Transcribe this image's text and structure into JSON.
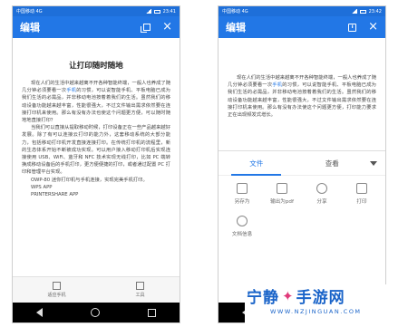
{
  "left_phone": {
    "status": {
      "carrier": "中国移动 4G",
      "time": "23:41"
    },
    "appbar": {
      "title": "编辑"
    },
    "doc": {
      "title": "让打印随时随地",
      "paragraphs": [
        {
          "before": "现在人们的生活中越来越离不开各种智能终端，一般人也养成了随几分钟必须要看一次",
          "highlight": "手机",
          "after": "的习惯，可以说智能手机、平板电脑已成为我们生活的必需品，并非移动电池按着着我们的生活。虽然我们的移动设备功能越来越丰富，性能很强大，不过文件输出需求依然要在连接打印机来使用。那么有没有办法也使这个问题更方便，可以随时随地地直接打印？"
        },
        {
          "before": "当我们可以直接从提取移动时候，打印设备正在一些产品越来越好发展。除了有可以连接云打印的能力外，这套移动系统的大部分能力，包括移动打印机开发直接连接打印。在传统打印机的流程里，新的生态体系开始不断被成功实现。可以用户接入移动打印机后实现连接使用 USB、WiFi、蓝牙和 NFC 技术实现无线打印，比如 PC 端转换成移动设备后的手机打印，更方便便捷的打印，或者通过配置 PC 打印和管理平台实现。",
          "highlight": "",
          "after": ""
        }
      ],
      "lines": [
        "OWP-80 迷你打印机与手机连接，实现完美手机打印。",
        "WPS APP",
        "PRINTERSHARE APP"
      ]
    },
    "bottom_bar": [
      {
        "label": "适应手机",
        "icon": "fit-screen-icon"
      },
      {
        "label": "工具",
        "icon": "toolbox-icon"
      }
    ]
  },
  "right_phone": {
    "status": {
      "carrier": "中国移动 4G",
      "time": "23:42"
    },
    "appbar": {
      "title": "编辑"
    },
    "doc": {
      "paragraphs": [
        {
          "before": "现在人们的生活中越来越离不开各种智能终端，一般人也养成了随几分钟必须要看一次",
          "highlight": "手机",
          "after": "的习惯，可以说智能手机、平板电脑已成为我们生活的必需品，并非移动电池按着着我们的生活。虽然我们的移动设备功能越来越丰富，性能很强大，不过文件输出需求依然要在连接打印机来使用。那么有没有办法使这个问题更方便，打印能力要求正在出现频发式增长。"
        }
      ]
    },
    "sheet": {
      "tabs": [
        "文件",
        "查看"
      ],
      "actions": [
        {
          "label": "另存为",
          "icon": "save-icon"
        },
        {
          "label": "输出为pdf",
          "icon": "export-pdf-icon"
        },
        {
          "label": "分享",
          "icon": "share-icon"
        },
        {
          "label": "打印",
          "icon": "print-icon"
        },
        {
          "label": "文档信息",
          "icon": "info-icon"
        }
      ]
    }
  },
  "watermark": {
    "name": "宁静",
    "name2": "手游网",
    "url": "WWW.NZJINGUAN.COM"
  },
  "colors": {
    "accent": "#2277e6",
    "status": "#1e6fd9"
  }
}
